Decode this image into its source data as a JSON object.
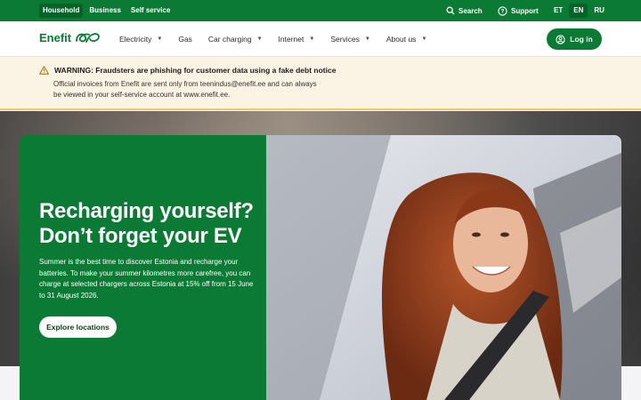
{
  "topbar": {
    "segments": [
      "Household",
      "Business",
      "Self service"
    ],
    "active_segment": "Household",
    "search_label": "Search",
    "support_label": "Support",
    "languages": [
      "ET",
      "EN",
      "RU"
    ],
    "active_language": "EN"
  },
  "nav": {
    "logo_text": "Enefit",
    "items": [
      {
        "label": "Electricity",
        "has_dropdown": true
      },
      {
        "label": "Gas",
        "has_dropdown": false
      },
      {
        "label": "Car charging",
        "has_dropdown": true
      },
      {
        "label": "Internet",
        "has_dropdown": true
      },
      {
        "label": "Services",
        "has_dropdown": true
      },
      {
        "label": "About us",
        "has_dropdown": true
      }
    ],
    "login_label": "Log in"
  },
  "warning": {
    "title": "WARNING: Fraudsters are phishing for customer data using a fake debt notice",
    "body": "Official invoices from Enefit are sent only from teenindus@enefit.ee and can always be viewed in your self-service account at www.enefit.ee."
  },
  "hero": {
    "title": "Recharging yourself? Don’t forget your EV",
    "text": "Summer is the best time to discover Estonia and recharge your batteries. To make your summer kilometres more carefree, you can charge at selected chargers across Estonia at 15% off from 15 June to 31 August 2026.",
    "button_label": "Explore locations"
  },
  "colors": {
    "brand_green": "#0b7a34",
    "warning_bg": "#fbf3e4",
    "warning_accent": "#efc96f"
  },
  "icons": [
    "search-icon",
    "support-icon",
    "logo-icon",
    "warning-icon",
    "user-icon",
    "chevron-down-icon"
  ]
}
